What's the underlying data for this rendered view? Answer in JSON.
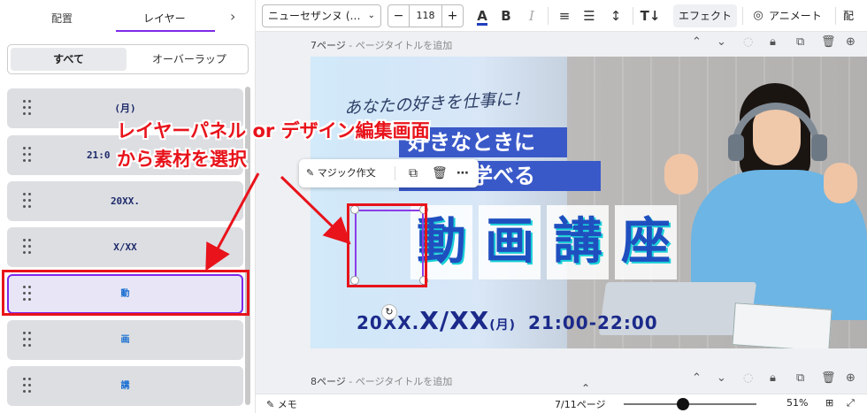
{
  "left_panel": {
    "tabs": [
      {
        "label": "配置"
      },
      {
        "label": "レイヤー"
      }
    ],
    "segments": [
      {
        "label": "すべて"
      },
      {
        "label": "オーバーラップ"
      }
    ],
    "layers": [
      {
        "text": "(月)"
      },
      {
        "text": "21:0"
      },
      {
        "text": "20XX."
      },
      {
        "text": "X/XX"
      },
      {
        "text": "動"
      },
      {
        "text": "画"
      },
      {
        "text": "講"
      }
    ]
  },
  "toolbar": {
    "font_name": "ニューセザンヌ (…",
    "font_size": "118",
    "effects_label": "エフェクト",
    "animate_label": "アニメート",
    "arrange_label": "配置"
  },
  "pages": [
    {
      "title": "7ページ",
      "subtitle": "- ページタイトルを追加"
    },
    {
      "title": "8ページ",
      "subtitle": "- ページタイトルを追加"
    }
  ],
  "design": {
    "script_text": "あなたの好きを仕事に！",
    "band1": "好きなときに",
    "band2": "自由に学べる",
    "kanji": [
      "動",
      "画",
      "講",
      "座"
    ],
    "date_prefix": "20XX.",
    "date_main": "X/XX",
    "date_day": "(月)",
    "time": "21:00-22:00"
  },
  "context_menu": {
    "magic_label": "マジック作文"
  },
  "annotation": {
    "line1": "レイヤーパネル or デザイン編集画面",
    "line2": "から素材を選択"
  },
  "bottom_bar": {
    "memo_label": "メモ",
    "page_counter": "7/11ページ",
    "zoom": "51%"
  },
  "colors": {
    "accent": "#7d2ae8",
    "annotation_red": "#e8131b",
    "title_blue": "#1f4fbf"
  }
}
